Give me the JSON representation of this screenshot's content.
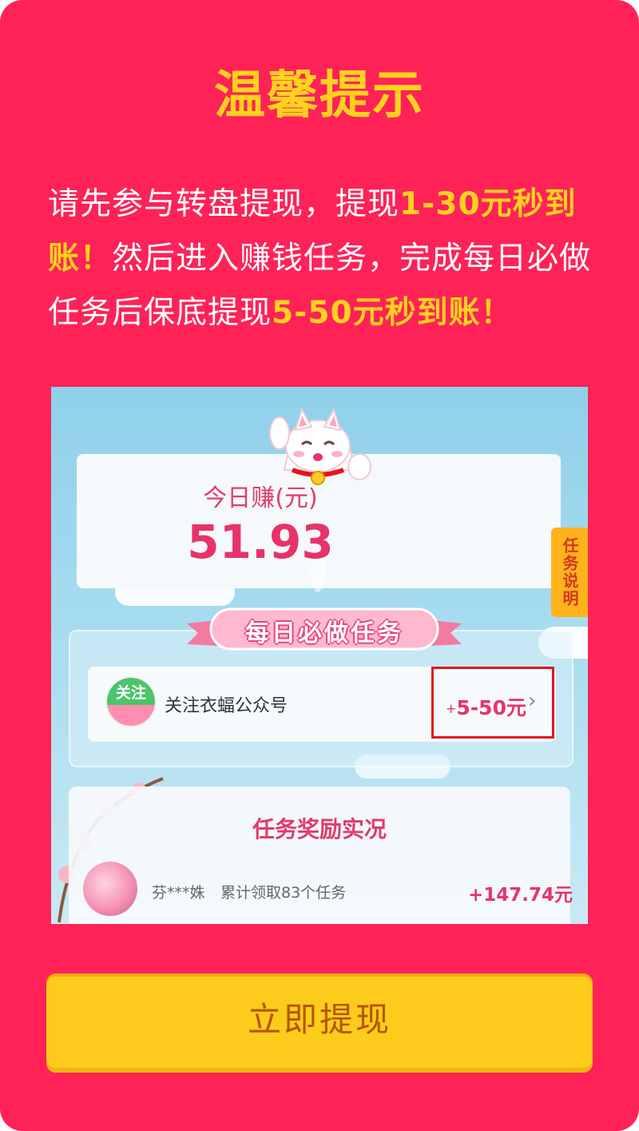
{
  "dialog": {
    "title": "温馨提示",
    "message": {
      "part1": "请先参与转盘提现，提现",
      "highlight1": "1-30元秒到账！",
      "part2": "然后进入赚钱任务，完成每日必做任务后保底提现",
      "highlight2": "5-50元秒到账！"
    },
    "button_label": "立即提现"
  },
  "screenshot": {
    "earn_label": "今日赚(元)",
    "earn_value": "51.93",
    "side_tab": "任务说明",
    "section_banner": "每日必做任务",
    "task": {
      "icon_text": "关注",
      "name": "关注衣蝠公众号",
      "reward_plus": "+",
      "reward": "5-50元",
      "chevron": "›"
    },
    "records": {
      "title": "任务奖励实况",
      "rows": [
        {
          "user": "芬***姝",
          "desc": "累计领取83个任务",
          "amount": "+147.74元"
        }
      ]
    }
  },
  "colors": {
    "background": "#ff2257",
    "highlight": "#ffd21f",
    "button": "#fccb1b",
    "button_text": "#b65400",
    "reward": "#e8336a",
    "red_box": "#e5131b"
  }
}
